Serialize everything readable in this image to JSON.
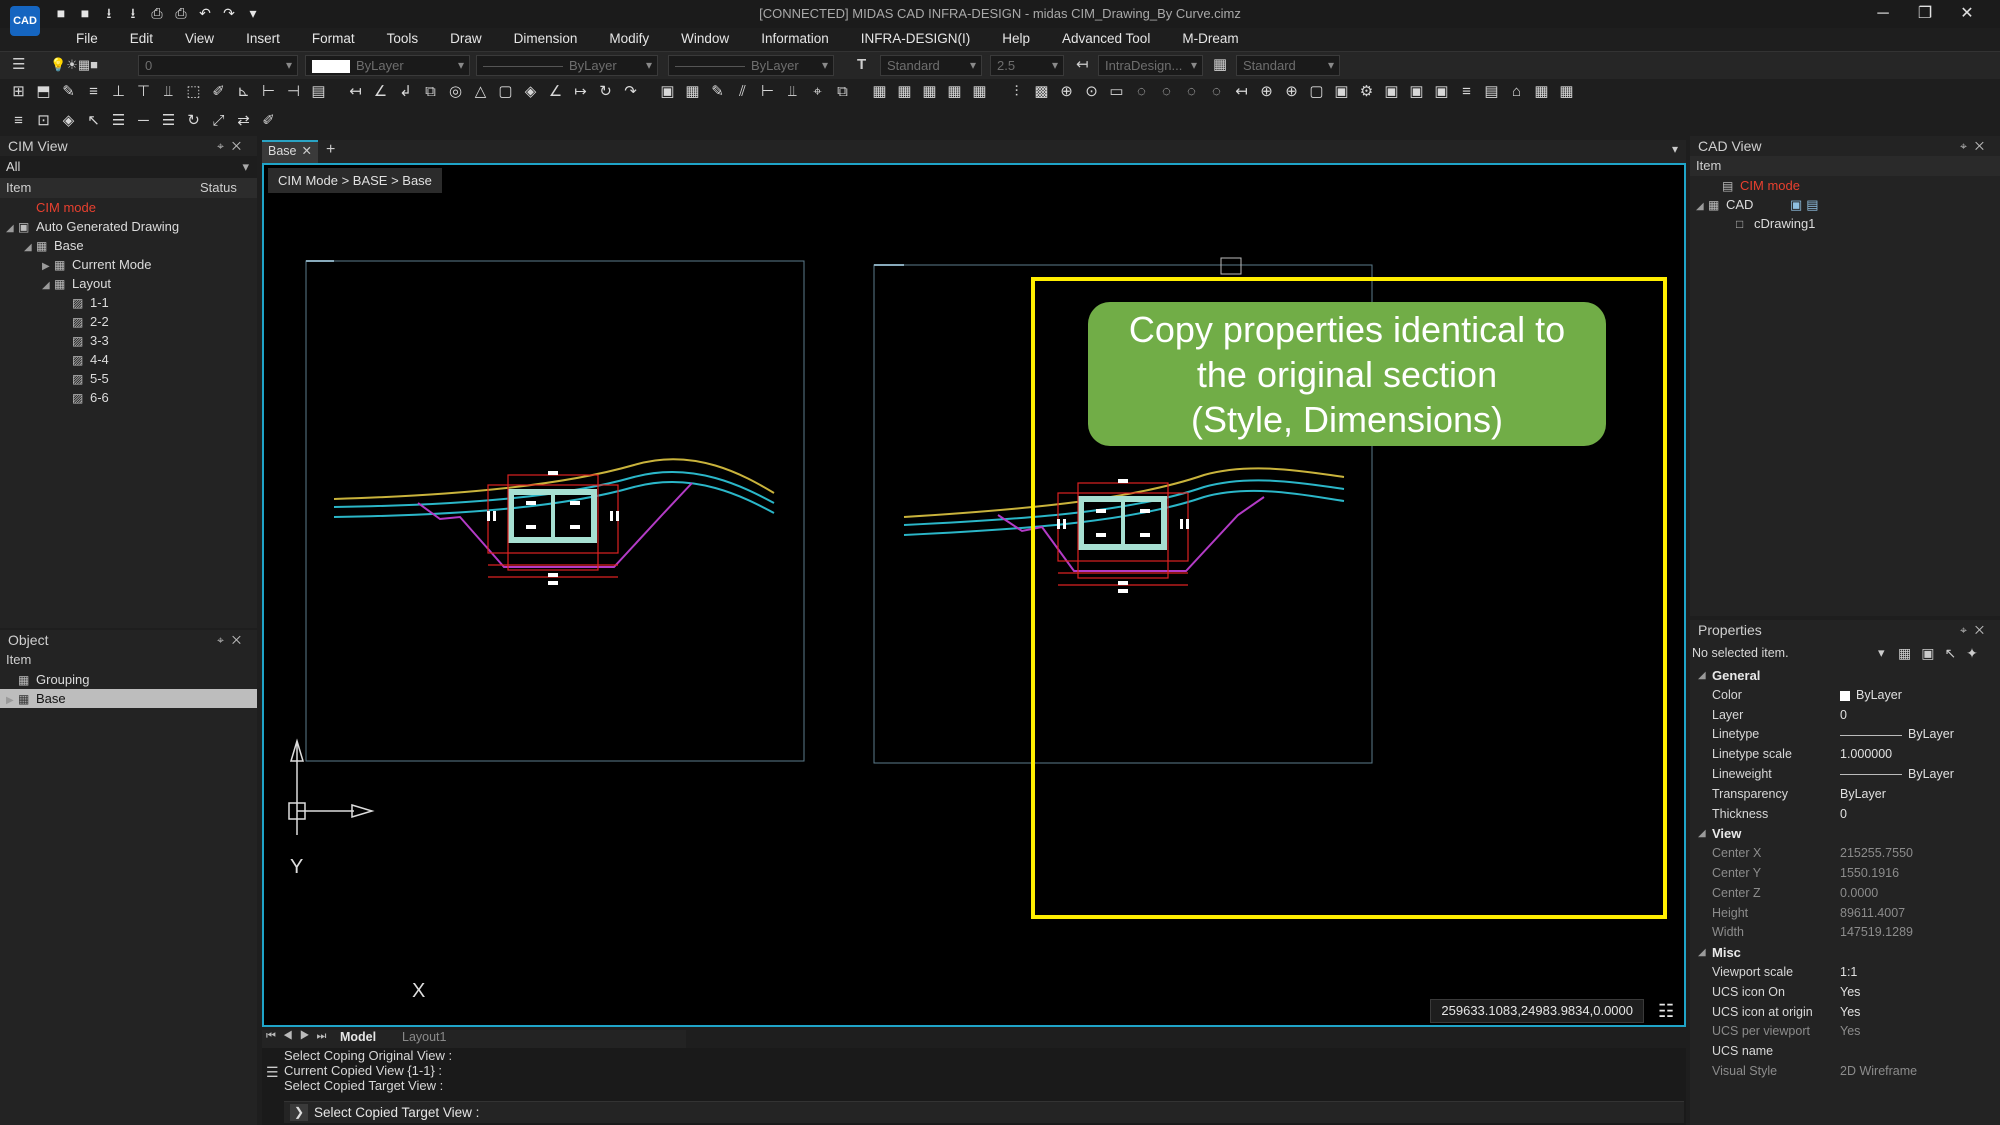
{
  "app": {
    "logo": "CAD",
    "window_title": "[CONNECTED] MIDAS CAD INFRA-DESIGN - midas CIM_Drawing_By Curve.cimz",
    "controls": [
      "─",
      "❐",
      "✕"
    ]
  },
  "qat_icons": [
    "■",
    "■",
    "⭳",
    "⭳",
    "⎙",
    "⎙",
    "↶",
    "↷",
    "▾"
  ],
  "menu": [
    "File",
    "Edit",
    "View",
    "Insert",
    "Format",
    "Tools",
    "Draw",
    "Dimension",
    "Modify",
    "Window",
    "Information",
    "INFRA-DESIGN(I)",
    "Help",
    "Advanced Tool",
    "M-Dream"
  ],
  "prop_toolbar": {
    "layer_value": "0",
    "color_value": "ByLayer",
    "linetype_value": "ByLayer",
    "lineweight_value": "ByLayer",
    "text_style": "Standard",
    "text_height": "2.5",
    "dim_style": "IntraDesign...",
    "table_style": "Standard"
  },
  "cim_view": {
    "title": "CIM View",
    "filter": "All",
    "col_item": "Item",
    "col_status": "Status",
    "tree": [
      {
        "label": "CIM mode",
        "level": 1,
        "exp": "",
        "icon": "",
        "red": true
      },
      {
        "label": "Auto Generated Drawing",
        "level": 0,
        "exp": "◢",
        "icon": "▣"
      },
      {
        "label": "Base",
        "level": 1,
        "exp": "◢",
        "icon": "▦"
      },
      {
        "label": "Current Mode",
        "level": 2,
        "exp": "▶",
        "icon": "▦"
      },
      {
        "label": "Layout",
        "level": 2,
        "exp": "◢",
        "icon": "▦"
      },
      {
        "label": "1-1",
        "level": 3,
        "exp": "",
        "icon": "▨"
      },
      {
        "label": "2-2",
        "level": 3,
        "exp": "",
        "icon": "▨"
      },
      {
        "label": "3-3",
        "level": 3,
        "exp": "",
        "icon": "▨"
      },
      {
        "label": "4-4",
        "level": 3,
        "exp": "",
        "icon": "▨"
      },
      {
        "label": "5-5",
        "level": 3,
        "exp": "",
        "icon": "▨"
      },
      {
        "label": "6-6",
        "level": 3,
        "exp": "",
        "icon": "▨"
      }
    ]
  },
  "object_panel": {
    "title": "Object",
    "col_item": "Item",
    "rows": [
      {
        "label": "Grouping",
        "exp": "",
        "icon": "▦"
      },
      {
        "label": "Base",
        "exp": "▶",
        "icon": "▦",
        "selected": true
      }
    ]
  },
  "document_tab": "Base",
  "breadcrumb": "CIM Mode > BASE > Base",
  "callout": {
    "line1": "Copy properties identical to",
    "line2": "the original section",
    "line3": "(Style, Dimensions)"
  },
  "axis": {
    "x": "X",
    "y": "Y"
  },
  "coordinates": "259633.1083,24983.9834,0.0000",
  "layout_tabs": [
    "Model",
    "Layout1"
  ],
  "command_history": [
    "Select Coping Original View :",
    "Current Copied View {1-1} :",
    "Select Copied Target View :"
  ],
  "command_prompt": "Select Copied Target View :",
  "cad_view": {
    "title": "CAD View",
    "col_item": "Item",
    "tree": [
      {
        "label": "CIM mode",
        "red": true,
        "exp": "",
        "icon": "▤"
      },
      {
        "label": "CAD",
        "exp": "◢",
        "icon": "▦"
      },
      {
        "label": "cDrawing1",
        "exp": "",
        "icon": "□"
      }
    ]
  },
  "properties": {
    "title": "Properties",
    "selection": "No selected item.",
    "groups": [
      {
        "name": "General",
        "rows": [
          {
            "key": "Color",
            "value": "ByLayer",
            "swatch": "#ffffff"
          },
          {
            "key": "Layer",
            "value": "0"
          },
          {
            "key": "Linetype",
            "value": "ByLayer",
            "line": true
          },
          {
            "key": "Linetype scale",
            "value": "1.000000"
          },
          {
            "key": "Lineweight",
            "value": "ByLayer",
            "line": true
          },
          {
            "key": "Transparency",
            "value": "ByLayer"
          },
          {
            "key": "Thickness",
            "value": "0"
          }
        ]
      },
      {
        "name": "View",
        "rows": [
          {
            "key": "Center X",
            "value": "215255.7550",
            "dim": true
          },
          {
            "key": "Center Y",
            "value": "1550.1916",
            "dim": true
          },
          {
            "key": "Center Z",
            "value": "0.0000",
            "dim": true
          },
          {
            "key": "Height",
            "value": "89611.4007",
            "dim": true
          },
          {
            "key": "Width",
            "value": "147519.1289",
            "dim": true
          }
        ]
      },
      {
        "name": "Misc",
        "rows": [
          {
            "key": "Viewport scale",
            "value": "1:1"
          },
          {
            "key": "UCS icon On",
            "value": "Yes"
          },
          {
            "key": "UCS icon at origin",
            "value": "Yes"
          },
          {
            "key": "UCS per viewport",
            "value": "Yes",
            "dim": true
          },
          {
            "key": "UCS name",
            "value": ""
          },
          {
            "key": "Visual Style",
            "value": "2D Wireframe",
            "dim": true
          }
        ]
      }
    ]
  },
  "colors": {
    "accent": "#1fa4c8",
    "highlight": "#ffee00",
    "callout_bg": "#71ad47",
    "cim_mode_red": "#e8402f",
    "selection": "#bdbdbd"
  }
}
